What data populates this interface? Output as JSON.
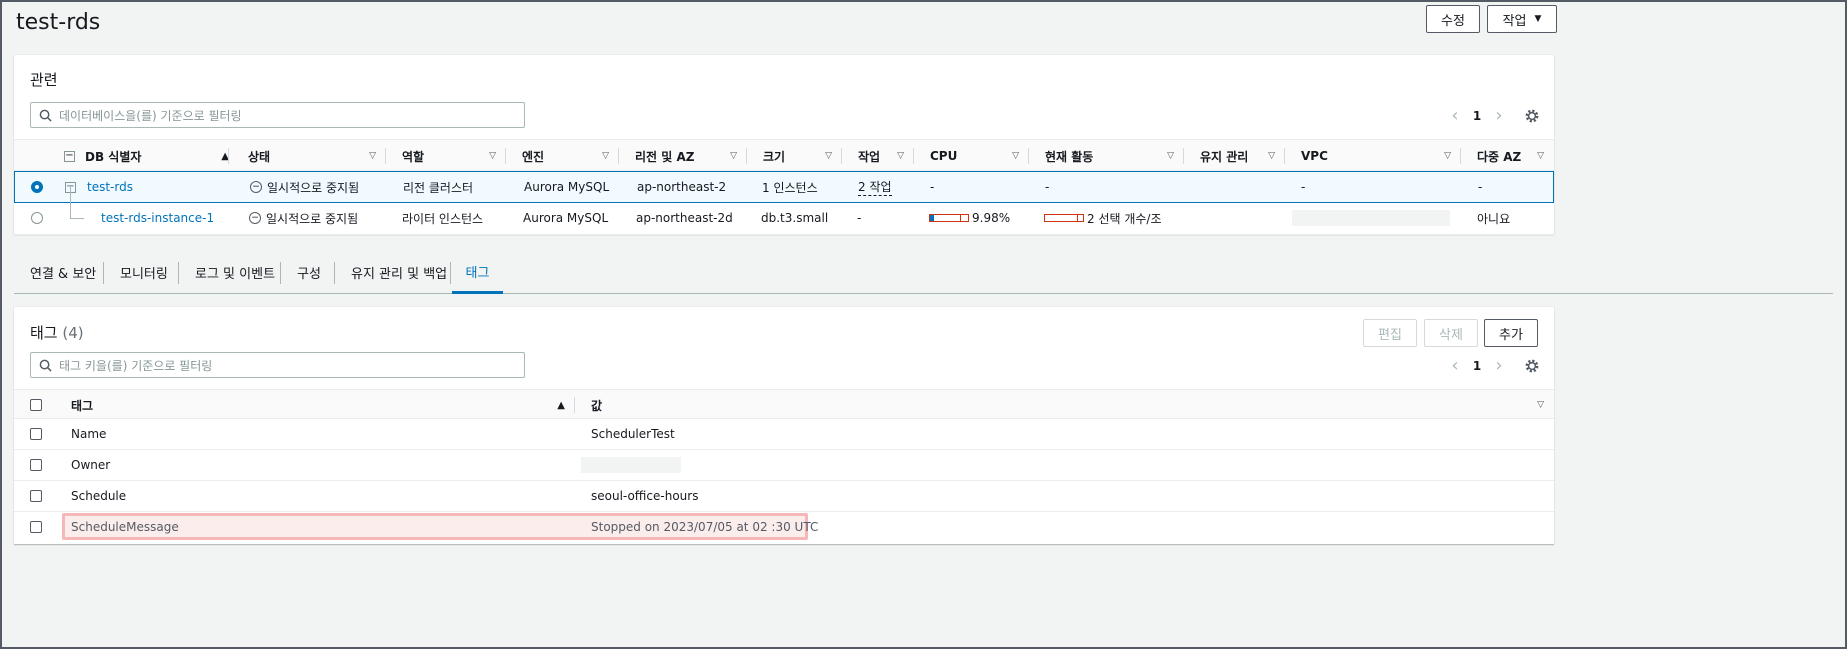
{
  "page": {
    "title": "test-rds"
  },
  "header_buttons": {
    "edit": "수정",
    "actions": "작업"
  },
  "related": {
    "title": "관련",
    "search_placeholder": "데이터베이스을(를) 기준으로 필터링",
    "page": "1",
    "columns": [
      "DB 식별자",
      "상태",
      "역할",
      "엔진",
      "리전 및 AZ",
      "크기",
      "작업",
      "CPU",
      "현재 활동",
      "유지 관리",
      "VPC",
      "다중 AZ"
    ],
    "rows": [
      {
        "id": "test-rds",
        "status": "일시적으로 중지됨",
        "role": "리전 클러스터",
        "engine": "Aurora MySQL",
        "region": "ap-northeast-2",
        "size": "1 인스턴스",
        "actions": "2 작업",
        "cpu": "-",
        "activity": "-",
        "maint": "",
        "vpc": "-",
        "multiaz": "-"
      },
      {
        "id": "test-rds-instance-1",
        "status": "일시적으로 중지됨",
        "role": "라이터 인스턴스",
        "engine": "Aurora MySQL",
        "region": "ap-northeast-2d",
        "size": "db.t3.small",
        "actions": "-",
        "cpu": "9.98%",
        "cpu_fraction": 0.0998,
        "activity": "2 선택 개수/조",
        "maint": "",
        "vpc": "",
        "multiaz": "아니요"
      }
    ]
  },
  "tabs": [
    "연결 & 보안",
    "모니터링",
    "로그 및 이벤트",
    "구성",
    "유지 관리 및 백업",
    "태그"
  ],
  "tags": {
    "title": "태그",
    "count": "(4)",
    "buttons": {
      "edit": "편집",
      "delete": "삭제",
      "add": "추가"
    },
    "search_placeholder": "태그 키을(를) 기준으로 필터링",
    "page": "1",
    "columns": {
      "key": "태그",
      "value": "값"
    },
    "rows": [
      {
        "key": "Name",
        "value": "SchedulerTest"
      },
      {
        "key": "Owner",
        "value": ""
      },
      {
        "key": "Schedule",
        "value": "seoul-office-hours"
      },
      {
        "key": "ScheduleMessage",
        "value": "Stopped on 2023/07/05 at 02 :30 UTC"
      }
    ]
  },
  "colors": {
    "accent": "#0073bb",
    "highlight": "#f5b7b7"
  }
}
